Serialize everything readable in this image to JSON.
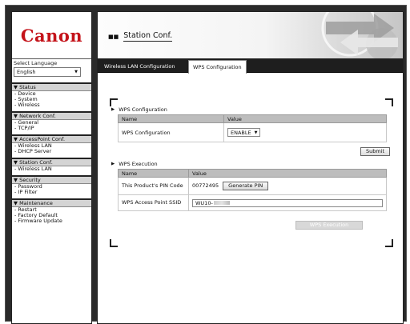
{
  "sidebar": {
    "logo": "Canon",
    "language": {
      "label": "Select Language",
      "selected": "English"
    },
    "groups": [
      {
        "title": "▼ Status",
        "items": [
          "Device",
          "System",
          "Wireless"
        ]
      },
      {
        "title": "▼ Network Conf.",
        "items": [
          "General",
          "TCP/IP"
        ]
      },
      {
        "title": "▼ AccessPoint Conf.",
        "items": [
          "Wireless LAN",
          "DHCP Server"
        ]
      },
      {
        "title": "▼ Station Conf.",
        "items": [
          "Wireless LAN"
        ]
      },
      {
        "title": "▼ Security",
        "items": [
          "Password",
          "IP Filter"
        ]
      },
      {
        "title": "▼ Maintenance",
        "items": [
          "Restart",
          "Factory Default",
          "Firmware Update"
        ]
      }
    ]
  },
  "header": {
    "title": "Station Conf."
  },
  "tabs": [
    {
      "label": "Wireless LAN Configuration",
      "active": false
    },
    {
      "label": "WPS Configuration",
      "active": true
    }
  ],
  "wps_config": {
    "section_title": "WPS Configuration",
    "col_name": "Name",
    "col_value": "Value",
    "row_label": "WPS Configuration",
    "row_value": "ENABLE",
    "submit_label": "Submit"
  },
  "wps_exec": {
    "section_title": "WPS Execution",
    "col_name": "Name",
    "col_value": "Value",
    "pin_label": "This Product's PIN Code",
    "pin_value": "00772495",
    "generate_label": "Generate PIN",
    "ssid_label": "WPS Access Point SSID",
    "ssid_value": "WU10-",
    "execute_label": "WPS Execution"
  },
  "colors": {
    "brand": "#c4131a",
    "tab_bar": "#1e1e1e",
    "table_header": "#bdbdbd"
  }
}
